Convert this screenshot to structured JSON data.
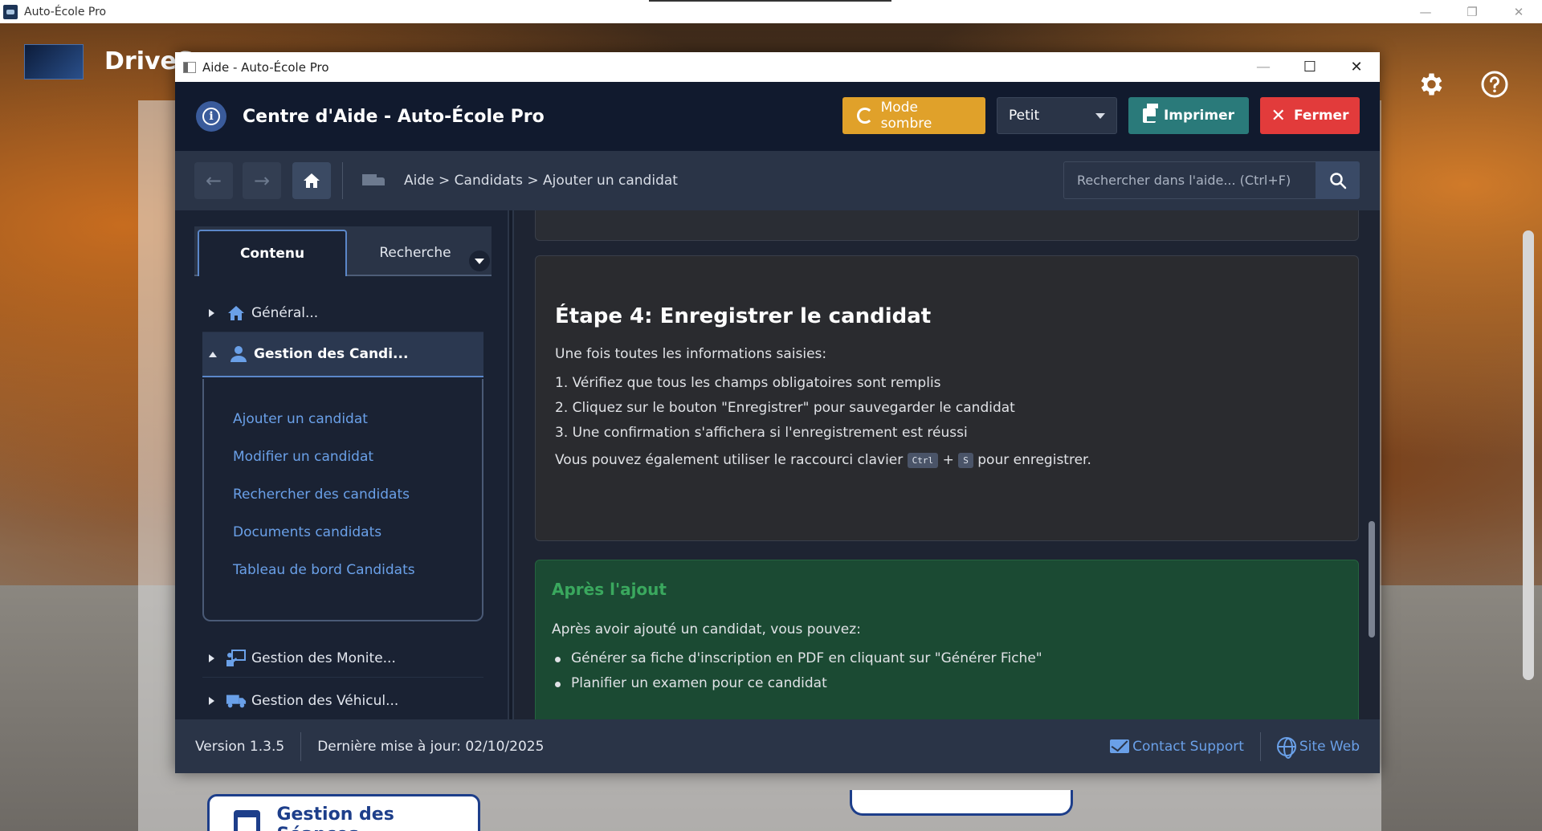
{
  "background_app": {
    "title": "Auto-École Pro",
    "brand": "DriveS",
    "card_label": "Gestion des Séances"
  },
  "dialog": {
    "window_title": "Aide - Auto-École Pro",
    "header_title": "Centre d'Aide - Auto-École Pro",
    "buttons": {
      "dark_mode": "Mode sombre",
      "size_select": "Petit",
      "print": "Imprimer",
      "close": "Fermer"
    },
    "breadcrumb": "Aide > Candidats > Ajouter un candidat",
    "search_placeholder": "Rechercher dans l'aide... (Ctrl+F)"
  },
  "sidebar": {
    "tabs": [
      "Contenu",
      "Recherche"
    ],
    "items": [
      {
        "label": "Général...",
        "icon": "home-icon"
      },
      {
        "label": "Gestion des Candi...",
        "icon": "person-icon"
      },
      {
        "label": "Gestion des Monite...",
        "icon": "instructor-icon"
      },
      {
        "label": "Gestion des Véhicul...",
        "icon": "truck-icon"
      }
    ],
    "sublinks": [
      "Ajouter un candidat",
      "Modifier un candidat",
      "Rechercher des candidats",
      "Documents candidats",
      "Tableau de bord Candidats"
    ]
  },
  "content": {
    "step_title": "Étape 4: Enregistrer le candidat",
    "intro": "Une fois toutes les informations saisies:",
    "steps": [
      "1.  Vérifiez que tous les champs obligatoires sont remplis",
      "2.  Cliquez sur le bouton \"Enregistrer\" pour sauvegarder le candidat",
      "3.  Une confirmation s'affichera si l'enregistrement est réussi"
    ],
    "shortcut_text_before": "Vous pouvez également utiliser le raccourci clavier",
    "shortcut_key1": "Ctrl",
    "shortcut_plus": "+",
    "shortcut_key2": "S",
    "shortcut_text_after": "pour enregistrer.",
    "after_title": "Après l'ajout",
    "after_intro": "Après avoir ajouté un candidat, vous pouvez:",
    "after_items": [
      "Générer sa fiche d'inscription en PDF en cliquant sur \"Générer Fiche\"",
      "Planifier un examen pour ce candidat"
    ]
  },
  "footer": {
    "version": "Version 1.3.5",
    "updated": "Dernière mise à jour: 02/10/2025",
    "contact": "Contact Support",
    "website": "Site Web"
  },
  "colors": {
    "dark_mode_button": "#e0a12a",
    "print_button": "#2a7a7a",
    "close_button": "#e23b3b",
    "link": "#6aa0e8",
    "success_title": "#3aa85e"
  }
}
